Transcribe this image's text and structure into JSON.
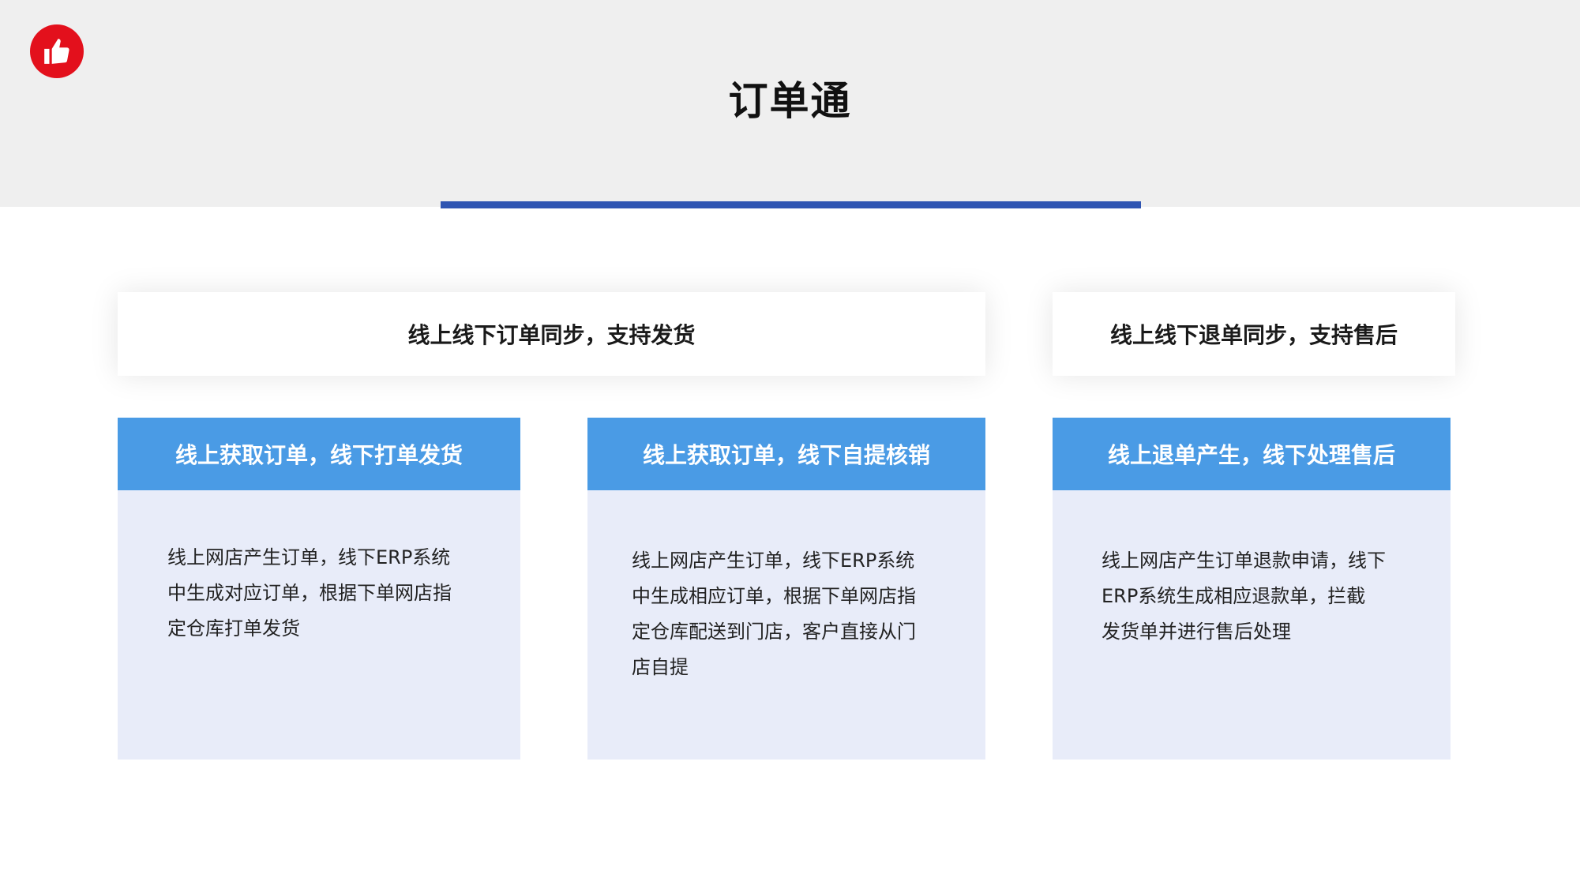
{
  "page": {
    "title": "订单通",
    "logo_icon": "thumbs-up-icon",
    "accent_color": "#2f55b2",
    "logo_color": "#e3101c"
  },
  "banners": [
    {
      "label": "线上线下订单同步，支持发货"
    },
    {
      "label": "线上线下退单同步，支持售后"
    }
  ],
  "cards": [
    {
      "heading": "线上获取订单，线下打单发货",
      "lines": [
        "线上网店产生订单，线下ERP系统",
        "中生成对应订单，根据下单网店指",
        "定仓库打单发货"
      ]
    },
    {
      "heading": "线上获取订单，线下自提核销",
      "lines": [
        "线上网店产生订单，线下ERP系统",
        "中生成相应订单，根据下单网店指",
        "定仓库配送到门店，客户直接从门",
        "店自提"
      ]
    },
    {
      "heading": "线上退单产生，线下处理售后",
      "lines": [
        "线上网店产生订单退款申请，线下",
        "ERP系统生成相应退款单，拦截",
        "发货单并进行售后处理"
      ]
    }
  ]
}
